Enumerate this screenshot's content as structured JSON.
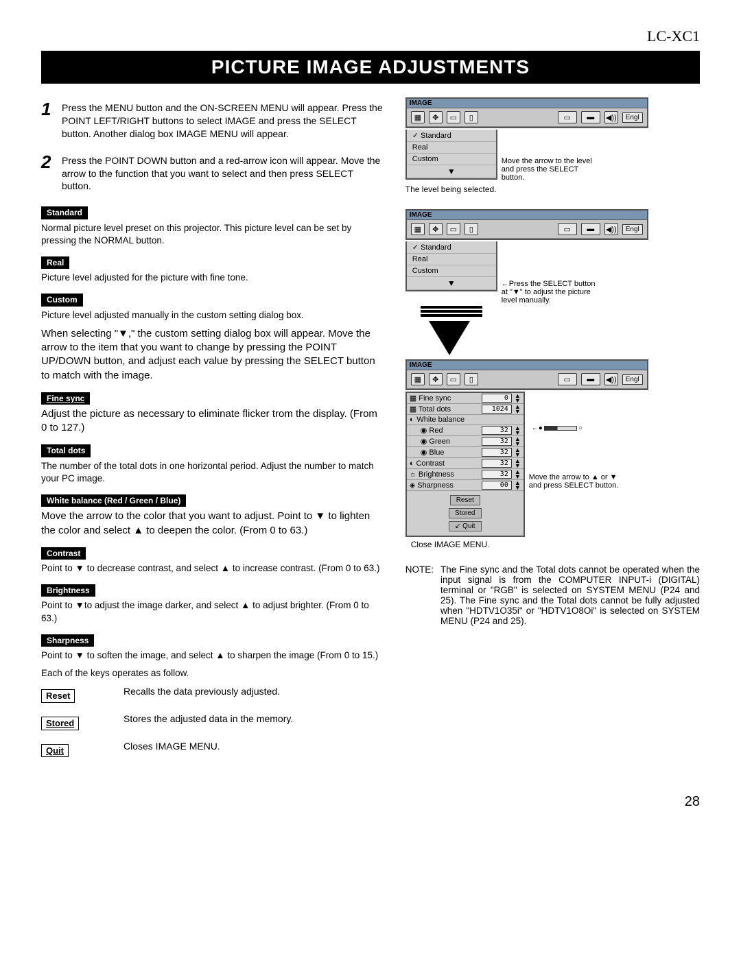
{
  "model": "LC-XC1",
  "banner": "PICTURE IMAGE ADJUSTMENTS",
  "steps": [
    {
      "num": "1",
      "text": "Press the MENU button and the ON-SCREEN MENU will appear. Press the POINT LEFT/RIGHT buttons to select IMAGE and press the SELECT button. Another dialog box IMAGE MENU will appear."
    },
    {
      "num": "2",
      "text": "Press the POINT DOWN button and a red-arrow icon will appear. Move the arrow to the function that you want to select and then press SELECT button."
    }
  ],
  "labels": {
    "standard": "Standard",
    "standard_desc": "Normal picture level preset on this projector. This picture level can be set by pressing the NORMAL button.",
    "real": "Real",
    "real_desc": "Picture level adjusted for the picture with fine tone.",
    "custom": "Custom",
    "custom_desc": "Picture level adjusted manually in the custom setting dialog box.",
    "custom_select": "When selecting \"▼,\" the custom setting dialog box will appear. Move the arrow to the item that you want to change by pressing the POINT UP/DOWN button, and adjust each value by pressing the SELECT button to match with the image.",
    "fine_sync": "Fine sync",
    "fine_sync_desc": "Adjust the picture as necessary to eliminate flicker trom the display. (From 0 to 127.)",
    "total_dots": "Total dots",
    "total_dots_desc": "The number of the total dots in one horizontal period. Adjust the number to match your PC image.",
    "white_balance": "White balance (Red / Green / Blue)",
    "white_balance_desc": "Move the arrow to the color that you want to adjust. Point to ▼ to lighten the color and select ▲ to deepen the color. (From 0 to 63.)",
    "contrast": "Contrast",
    "contrast_desc": "Point to ▼ to decrease contrast, and select ▲ to increase contrast. (From 0 to 63.)",
    "brightness": "Brightness",
    "brightness_desc": "Point to ▼to adjust the image darker, and select ▲ to adjust brighter. (From 0 to 63.)",
    "sharpness": "Sharpness",
    "sharpness_desc1": "Point to ▼ to soften the image, and select ▲ to sharpen the image (From 0 to 15.)",
    "sharpness_desc2": "Each of the keys operates as follow."
  },
  "keys": {
    "reset": "Reset",
    "reset_desc": "Recalls the data previously adjusted.",
    "stored": "Stored",
    "stored_desc": "Stores the adjusted data in the memory.",
    "quit": "Quit",
    "quit_desc": "Closes IMAGE MENU."
  },
  "right": {
    "menu_title": "IMAGE",
    "lang": "Engl",
    "levels": [
      "Standard",
      "Real",
      "Custom"
    ],
    "callout1": "Move the arrow to the level and press the SELECT button.",
    "annot1": "The level being selected.",
    "callout2": "Press the SELECT button at \"▼\" to adjust the picture level manually.",
    "adjust": {
      "fine_sync": "Fine sync",
      "fine_sync_val": "0",
      "total_dots": "Total dots",
      "total_dots_val": "1024",
      "white_balance": "White balance",
      "red": "Red",
      "red_val": "32",
      "green": "Green",
      "green_val": "32",
      "blue": "Blue",
      "blue_val": "32",
      "contrast": "Contrast",
      "contrast_val": "32",
      "brightness": "Brightness",
      "brightness_val": "32",
      "sharpness": "Sharpness",
      "sharpness_val": "00",
      "reset": "Reset",
      "stored": "Stored",
      "quit": "Quit"
    },
    "callout3": "Move the arrow to ▲ or ▼ and press SELECT button.",
    "annot3": "Close IMAGE MENU.",
    "note_label": "NOTE:",
    "note_body": "The Fine sync and the Total dots cannot be operated when the input signal is from the COMPUTER INPUT-i (DIGITAL) terminal or \"RGB\" is selected on SYSTEM MENU (P24 and 25). The Fine sync and the Total dots cannot be fully adjusted when \"HDTV1O35i\" or \"HDTV1O8Oi\" is selected on SYSTEM MENU (P24 and 25)."
  },
  "page": "28"
}
